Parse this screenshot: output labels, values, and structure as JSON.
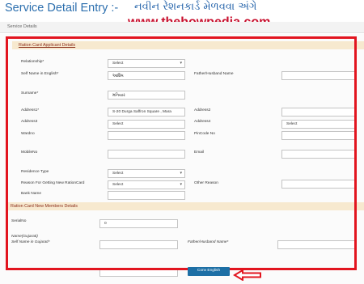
{
  "header": {
    "title": "Service Detail Entry :-",
    "gujarati_title": "નવીન રેશનકાર્ડ મેળવવા અંગે"
  },
  "watermark": "www.thehowpedia.com",
  "service_bar_label": "Service Details",
  "applicant_section": {
    "heading": "Ration Card Applicant Details",
    "relationship_label": "Relationship*",
    "relationship_value": "Select",
    "self_name_en_label": "Self Name in English*",
    "self_name_en_value": "આશિષ",
    "father_husband_label": "Father/Husband Name",
    "father_husband_value": "",
    "surname_label": "Surname*",
    "surname_value": "મનિયાર",
    "address1_label": "Address1*",
    "address1_value": "S-20 Durga Saffron Square , Mara",
    "address2_label": "Address2",
    "address2_value": "",
    "address3_label": "Address3",
    "address3_value": "Select",
    "address4_label": "Address4",
    "address4_value": "Select",
    "wardno_label": "Wardno",
    "wardno_value": "",
    "pincode_label": "PinCode No",
    "pincode_value": "",
    "mobile_label": "MobileNo",
    "mobile_value": "",
    "email_label": "Email",
    "email_value": "",
    "residence_label": "Residence Type",
    "residence_value": "Select",
    "reason_label": "Reason For Getting New RationCard",
    "reason_value": "Select",
    "other_reason_label": "Other Reason",
    "other_reason_value": "",
    "bank_label": "Bank Name"
  },
  "new_members_section": {
    "heading": "Ration Card New Members Details",
    "serial_label": "SerialNo",
    "serial_value": "0",
    "name_gujarati_label": "Name(Gujarati)",
    "self_name_gu_label": "Self Name in Gujarati*",
    "self_name_gu_value": "",
    "father_husband_label": "Father/Husband Name*",
    "father_husband_value": ""
  },
  "convert_button": "Conv English",
  "colors": {
    "highlight_frame": "#e2151f",
    "button": "#1d6fa5",
    "section_bar": "#f7e9cf",
    "title_blue": "#2c6fae"
  }
}
